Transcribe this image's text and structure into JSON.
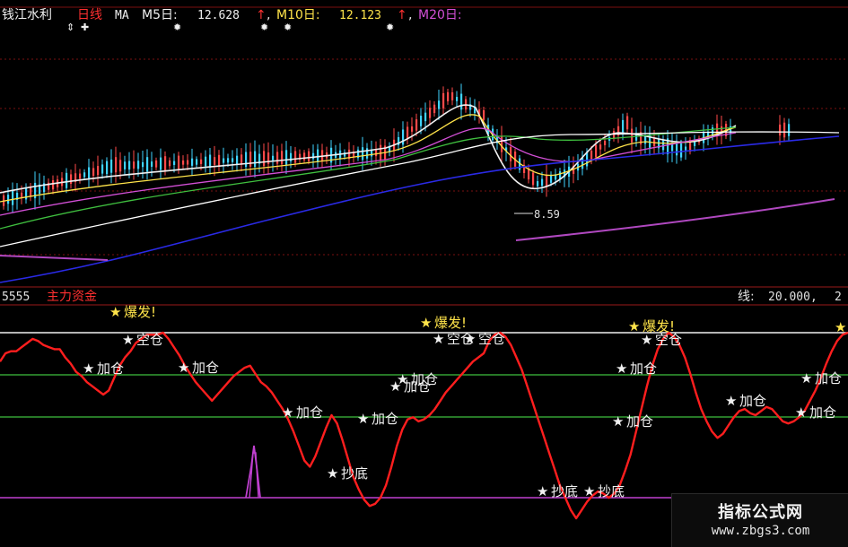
{
  "header": {
    "stock_name": "钱江水利",
    "period": "日线",
    "ma_label": "MA",
    "m5_label": "M5日:",
    "m5_value": "12.628",
    "m10_label": "M10日:",
    "m10_value": "12.123",
    "m20_label": "M20日:",
    "up_arrow": "↑",
    "comma": ","
  },
  "upper_panel": {
    "low_marker": "8.59",
    "colors": {
      "up": "#ff4a4a",
      "down": "#3fd4ff",
      "m5": "#f0f0f0",
      "m10": "#ffe44a",
      "m20": "#d24fd6",
      "m30": "#3fbf3f",
      "m60": "#ffffff",
      "m120": "#2a2ae6",
      "m250": "#b048c0"
    }
  },
  "lower_panel": {
    "indicator_code": "5555",
    "indicator_name": "主力资金",
    "right_label": "线:",
    "right_value": "20.000,",
    "right_extra": "2",
    "colors": {
      "line": "#ff1e1e",
      "spike": "#c040d0",
      "level_top": "#f0f0f0",
      "level_mid": "#3fbf3f",
      "level_low": "#c040d0"
    }
  },
  "signals": {
    "burst": "爆发!",
    "empty": "空仓",
    "add": "加仓",
    "bottom": "抄底"
  },
  "watermark": {
    "title": "指标公式网",
    "url": "www.zbgs3.com"
  },
  "chart_data": [
    {
      "type": "line",
      "title": "钱江水利 日线",
      "series": [
        {
          "name": "M5日",
          "last_value": 12.628
        },
        {
          "name": "M10日",
          "last_value": 12.123
        },
        {
          "name": "M20日"
        }
      ],
      "annotations": [
        {
          "text": "8.59",
          "meaning": "period low"
        }
      ],
      "grid": false
    },
    {
      "type": "line",
      "title": "主力资金",
      "reference_levels": [
        20,
        50,
        80,
        100
      ],
      "values": [
        86,
        90,
        91,
        91,
        93,
        95,
        97,
        96,
        94,
        93,
        92,
        92,
        88,
        85,
        81,
        79,
        76,
        74,
        72,
        70,
        72,
        78,
        84,
        88,
        91,
        95,
        97,
        99,
        99,
        99,
        100,
        97,
        93,
        89,
        84,
        80,
        76,
        73,
        70,
        67,
        70,
        73,
        76,
        79,
        81,
        83,
        84,
        80,
        76,
        74,
        71,
        67,
        63,
        58,
        52,
        45,
        38,
        35,
        40,
        47,
        54,
        60,
        56,
        48,
        39,
        30,
        24,
        19,
        16,
        17,
        20,
        26,
        35,
        45,
        53,
        58,
        59,
        57,
        58,
        60,
        63,
        67,
        71,
        74,
        77,
        80,
        83,
        86,
        88,
        90,
        96,
        99,
        100,
        98,
        94,
        88,
        82,
        74,
        66,
        58,
        50,
        42,
        34,
        26,
        20,
        14,
        10,
        14,
        18,
        21,
        23,
        22,
        20,
        22,
        26,
        33,
        41,
        52,
        63,
        74,
        84,
        92,
        97,
        100,
        98,
        94,
        88,
        80,
        71,
        63,
        57,
        52,
        49,
        51,
        55,
        59,
        62,
        63,
        61,
        60,
        62,
        64,
        63,
        60,
        57,
        56,
        57,
        59,
        62,
        67,
        72,
        78,
        85,
        91,
        96,
        99,
        100
      ],
      "signals": [
        {
          "label": "爆发!",
          "count": 3
        },
        {
          "label": "空仓",
          "count": 4
        },
        {
          "label": "加仓",
          "count": 12
        },
        {
          "label": "抄底",
          "count": 3
        }
      ]
    }
  ]
}
